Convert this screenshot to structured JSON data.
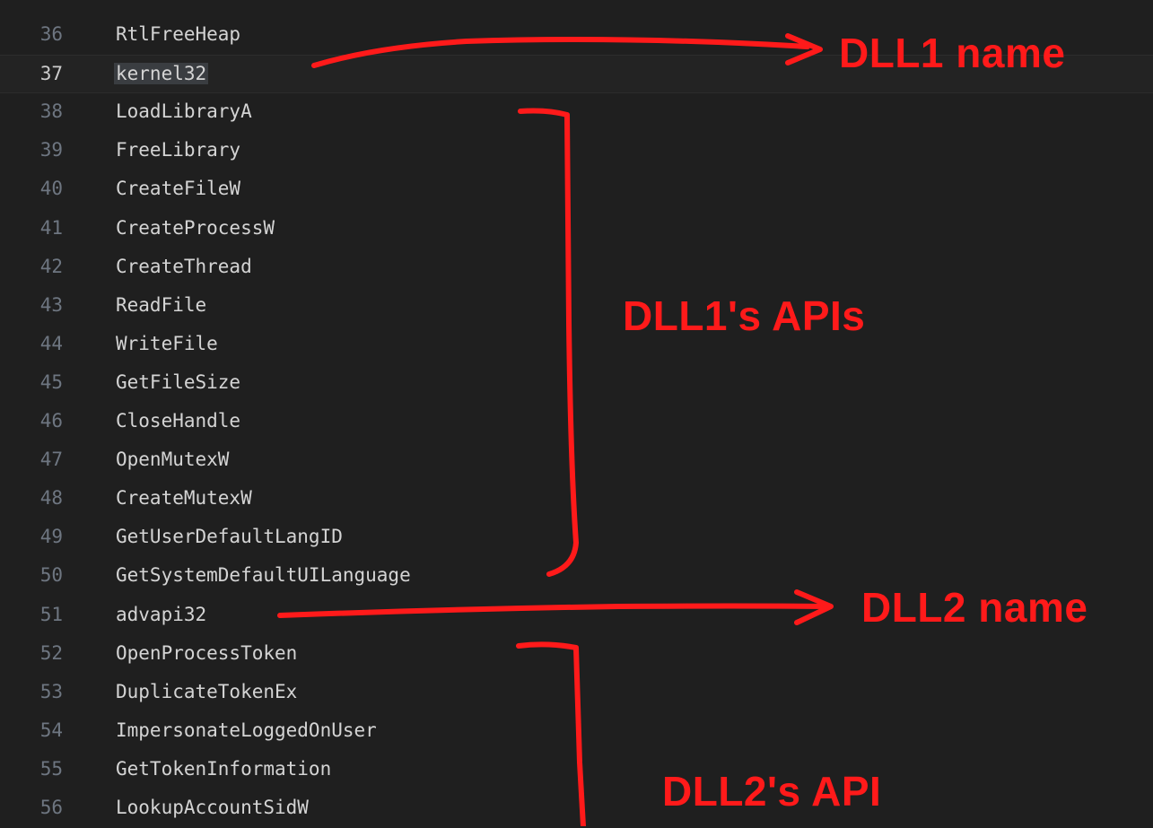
{
  "editor": {
    "lines": [
      {
        "number": "36",
        "text": "RtlFreeHeap",
        "current": false
      },
      {
        "number": "37",
        "text": "kernel32",
        "current": true
      },
      {
        "number": "38",
        "text": "LoadLibraryA",
        "current": false
      },
      {
        "number": "39",
        "text": "FreeLibrary",
        "current": false
      },
      {
        "number": "40",
        "text": "CreateFileW",
        "current": false
      },
      {
        "number": "41",
        "text": "CreateProcessW",
        "current": false
      },
      {
        "number": "42",
        "text": "CreateThread",
        "current": false
      },
      {
        "number": "43",
        "text": "ReadFile",
        "current": false
      },
      {
        "number": "44",
        "text": "WriteFile",
        "current": false
      },
      {
        "number": "45",
        "text": "GetFileSize",
        "current": false
      },
      {
        "number": "46",
        "text": "CloseHandle",
        "current": false
      },
      {
        "number": "47",
        "text": "OpenMutexW",
        "current": false
      },
      {
        "number": "48",
        "text": "CreateMutexW",
        "current": false
      },
      {
        "number": "49",
        "text": "GetUserDefaultLangID",
        "current": false
      },
      {
        "number": "50",
        "text": "GetSystemDefaultUILanguage",
        "current": false
      },
      {
        "number": "51",
        "text": "advapi32",
        "current": false
      },
      {
        "number": "52",
        "text": "OpenProcessToken",
        "current": false
      },
      {
        "number": "53",
        "text": "DuplicateTokenEx",
        "current": false
      },
      {
        "number": "54",
        "text": "ImpersonateLoggedOnUser",
        "current": false
      },
      {
        "number": "55",
        "text": "GetTokenInformation",
        "current": false
      },
      {
        "number": "56",
        "text": "LookupAccountSidW",
        "current": false
      }
    ]
  },
  "annotations": {
    "dll1_name": "DLL1 name",
    "dll1_apis": "DLL1's APIs",
    "dll2_name": "DLL2 name",
    "dll2_api": "DLL2's API"
  },
  "colors": {
    "background": "#1f1f1f",
    "code_text": "#d4d4d4",
    "line_number": "#6e7681",
    "annotation_red": "#ff1a1a"
  }
}
